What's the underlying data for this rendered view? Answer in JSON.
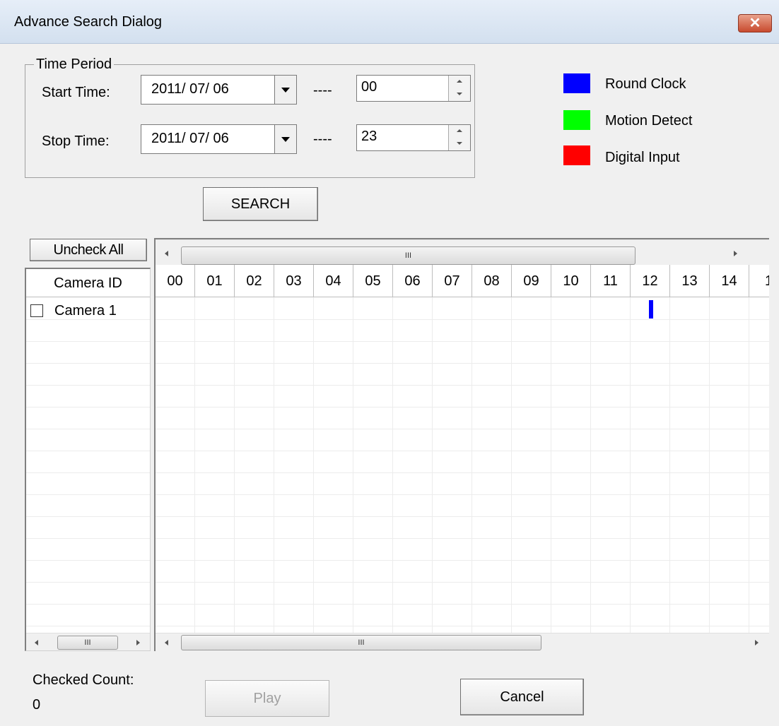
{
  "window": {
    "title": "Advance Search Dialog",
    "close_glyph": "✕"
  },
  "time_period": {
    "legend": "Time Period",
    "start_label": "Start Time:",
    "stop_label": "Stop Time:",
    "start_date": "2011/ 07/ 06",
    "stop_date": "2011/ 07/ 06",
    "separator": "----",
    "start_hour": "00",
    "stop_hour": "23"
  },
  "legend": [
    {
      "label": "Round Clock",
      "color": "#0000ff"
    },
    {
      "label": "Motion Detect",
      "color": "#00ff00"
    },
    {
      "label": "Digital Input",
      "color": "#ff0000"
    }
  ],
  "search_button": "SEARCH",
  "uncheck_all_button": "Uncheck All",
  "camera_list": {
    "header": "Camera ID",
    "cameras": [
      {
        "name": "Camera 1",
        "checked": false
      }
    ]
  },
  "timeline": {
    "hours": [
      "00",
      "01",
      "02",
      "03",
      "04",
      "05",
      "06",
      "07",
      "08",
      "09",
      "10",
      "11",
      "12",
      "13",
      "14",
      "1"
    ],
    "marks": [
      {
        "camera": "Camera 1",
        "hour": 12,
        "type": "Round Clock",
        "color": "#0000ff"
      }
    ]
  },
  "scrollbar_grip": "III",
  "checked_count": {
    "label": "Checked Count:",
    "value": "0"
  },
  "play_button": "Play",
  "cancel_button": "Cancel"
}
